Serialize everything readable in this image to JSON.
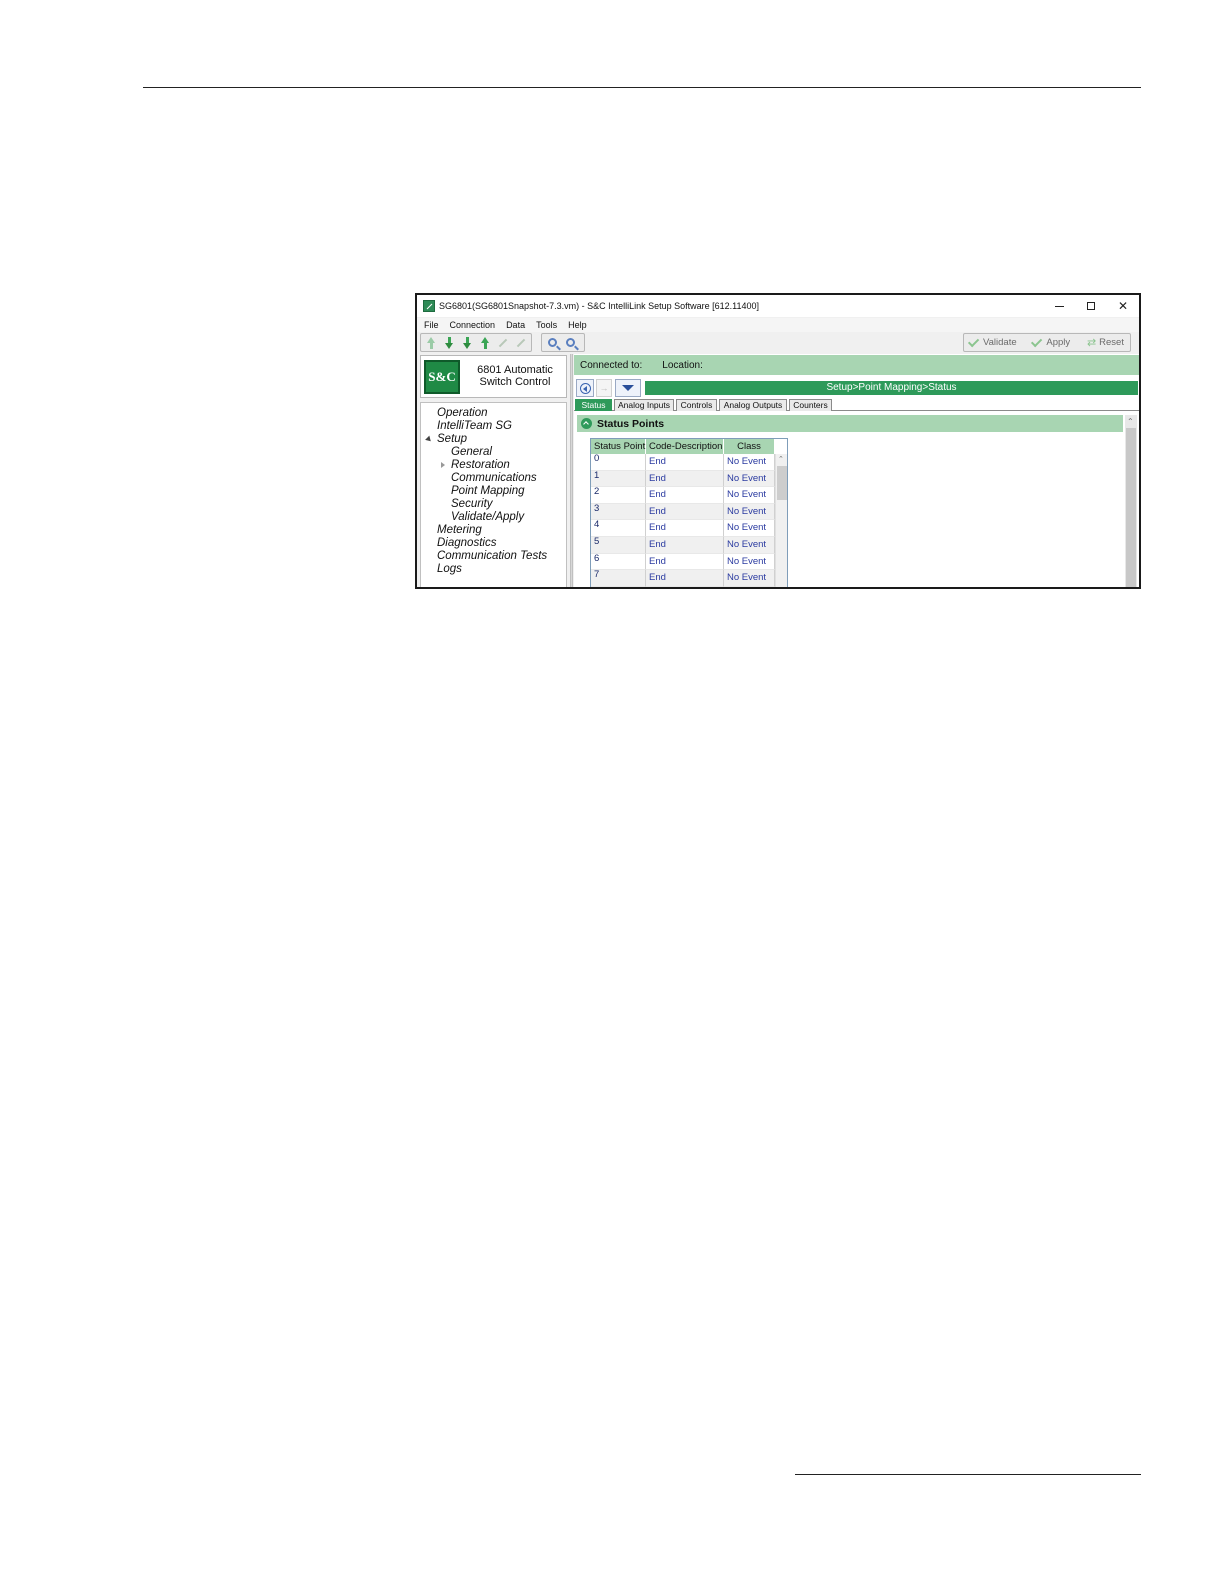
{
  "window": {
    "title": "SG6801(SG6801Snapshot-7.3.vm) - S&C IntelliLink Setup Software [612.11400]"
  },
  "menu": [
    "File",
    "Connection",
    "Data",
    "Tools",
    "Help"
  ],
  "toolbar": {
    "validate_label": "Validate",
    "apply_label": "Apply",
    "reset_label": "Reset"
  },
  "logo": {
    "mark": "S&C",
    "product": "6801 Automatic Switch Control"
  },
  "nav": {
    "operation": "Operation",
    "intelliteam": "IntelliTeam SG",
    "setup": "Setup",
    "general": "General",
    "restoration": "Restoration",
    "communications": "Communications",
    "point_mapping": "Point Mapping",
    "security": "Security",
    "validate_apply": "Validate/Apply",
    "metering": "Metering",
    "diagnostics": "Diagnostics",
    "communication_tests": "Communication Tests",
    "logs": "Logs"
  },
  "connection": {
    "connected_label": "Connected to:",
    "location_label": "Location:"
  },
  "breadcrumb": "Setup>Point Mapping>Status",
  "tabs": [
    "Status",
    "Analog Inputs",
    "Controls",
    "Analog Outputs",
    "Counters"
  ],
  "section_title": "Status Points",
  "grid": {
    "headers": [
      "Status Point",
      "Code-Description",
      "Class"
    ],
    "rows": [
      {
        "point": "0",
        "code": "End",
        "cls": "No Event"
      },
      {
        "point": "1",
        "code": "End",
        "cls": "No Event"
      },
      {
        "point": "2",
        "code": "End",
        "cls": "No Event"
      },
      {
        "point": "3",
        "code": "End",
        "cls": "No Event"
      },
      {
        "point": "4",
        "code": "End",
        "cls": "No Event"
      },
      {
        "point": "5",
        "code": "End",
        "cls": "No Event"
      },
      {
        "point": "6",
        "code": "End",
        "cls": "No Event"
      },
      {
        "point": "7",
        "code": "End",
        "cls": "No Event"
      }
    ]
  },
  "colors": {
    "accent_green": "#2e9a5a",
    "light_green": "#a8d5b2",
    "link_blue": "#2a3aa0"
  }
}
